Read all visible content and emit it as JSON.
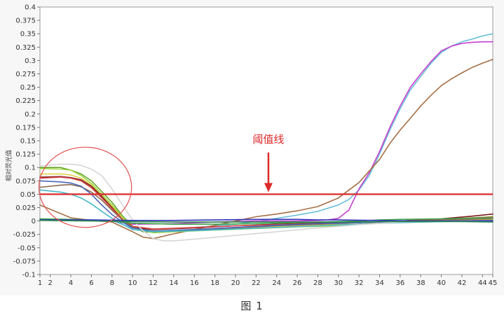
{
  "figure": {
    "caption": "图 1",
    "background": "#f7f7f7"
  },
  "chart_data": {
    "type": "line",
    "title": "",
    "xlabel": "",
    "ylabel": "相对荧光值",
    "xlim": [
      1,
      45
    ],
    "ylim": [
      -0.1,
      0.4
    ],
    "x_ticks": [
      1,
      2,
      4,
      6,
      8,
      10,
      12,
      14,
      16,
      18,
      20,
      22,
      24,
      26,
      28,
      30,
      32,
      34,
      36,
      38,
      40,
      42,
      44,
      45
    ],
    "y_ticks": [
      "0.4",
      "0.375",
      "0.35",
      "0.325",
      "0.3",
      "0.275",
      "0.25",
      "0.225",
      "0.2",
      "0.175",
      "0.15",
      "0.125",
      "0.1",
      "0.075",
      "0.05",
      "0.025",
      "0",
      "-0.025",
      "-0.05",
      "-0.075",
      "-0.1"
    ],
    "grid": false,
    "threshold": {
      "label": "阈值线",
      "value": 0.05,
      "color": "#dd2a2a"
    },
    "highlight_circle": {
      "center": [
        5.4,
        0.063
      ],
      "radii": [
        4.5,
        0.075
      ],
      "color": "#e35050"
    },
    "series": [
      {
        "color": "#6cc0d8",
        "points": [
          [
            1,
            0.003
          ],
          [
            4,
            0.003
          ],
          [
            8,
            0.001
          ],
          [
            10,
            -0.014
          ],
          [
            12,
            -0.015
          ],
          [
            14,
            -0.014
          ],
          [
            16,
            -0.012
          ],
          [
            18,
            -0.009
          ],
          [
            20,
            -0.006
          ],
          [
            22,
            -0.001
          ],
          [
            24,
            0.005
          ],
          [
            26,
            0.011
          ],
          [
            28,
            0.018
          ],
          [
            30,
            0.03
          ],
          [
            31,
            0.04
          ],
          [
            32,
            0.058
          ],
          [
            33,
            0.085
          ],
          [
            34,
            0.125
          ],
          [
            35,
            0.17
          ],
          [
            36,
            0.21
          ],
          [
            37,
            0.245
          ],
          [
            38,
            0.27
          ],
          [
            39,
            0.295
          ],
          [
            40,
            0.315
          ],
          [
            41,
            0.327
          ],
          [
            42,
            0.335
          ],
          [
            43,
            0.34
          ],
          [
            44,
            0.346
          ],
          [
            45,
            0.35
          ]
        ]
      },
      {
        "color": "#c43fd0",
        "points": [
          [
            1,
            0.002
          ],
          [
            4,
            0.002
          ],
          [
            8,
            0.0
          ],
          [
            10,
            -0.006
          ],
          [
            14,
            -0.005
          ],
          [
            18,
            -0.002
          ],
          [
            22,
            0.0
          ],
          [
            26,
            0.0
          ],
          [
            28,
            0.001
          ],
          [
            29,
            0.002
          ],
          [
            30,
            0.005
          ],
          [
            31,
            0.02
          ],
          [
            32,
            0.06
          ],
          [
            33,
            0.09
          ],
          [
            34,
            0.13
          ],
          [
            35,
            0.175
          ],
          [
            36,
            0.215
          ],
          [
            37,
            0.25
          ],
          [
            38,
            0.275
          ],
          [
            39,
            0.298
          ],
          [
            40,
            0.318
          ],
          [
            41,
            0.327
          ],
          [
            42,
            0.332
          ],
          [
            43,
            0.334
          ],
          [
            44,
            0.335
          ],
          [
            45,
            0.335
          ]
        ]
      },
      {
        "color": "#a57048",
        "points": [
          [
            1,
            0.03
          ],
          [
            4,
            0.006
          ],
          [
            6,
            0.001
          ],
          [
            8,
            -0.002
          ],
          [
            10,
            -0.02
          ],
          [
            11,
            -0.03
          ],
          [
            12,
            -0.033
          ],
          [
            14,
            -0.024
          ],
          [
            16,
            -0.016
          ],
          [
            18,
            -0.008
          ],
          [
            20,
            0.0
          ],
          [
            22,
            0.008
          ],
          [
            24,
            0.013
          ],
          [
            26,
            0.019
          ],
          [
            28,
            0.027
          ],
          [
            30,
            0.043
          ],
          [
            32,
            0.072
          ],
          [
            34,
            0.115
          ],
          [
            35,
            0.145
          ],
          [
            36,
            0.17
          ],
          [
            37,
            0.192
          ],
          [
            38,
            0.215
          ],
          [
            39,
            0.235
          ],
          [
            40,
            0.253
          ],
          [
            41,
            0.266
          ],
          [
            42,
            0.277
          ],
          [
            43,
            0.287
          ],
          [
            44,
            0.295
          ],
          [
            45,
            0.302
          ]
        ]
      },
      {
        "color": "#6aa32d",
        "points": [
          [
            1,
            0.1
          ],
          [
            3,
            0.1
          ],
          [
            4,
            0.095
          ],
          [
            5,
            0.088
          ],
          [
            6,
            0.075
          ],
          [
            7,
            0.055
          ],
          [
            8,
            0.035
          ],
          [
            9,
            0.01
          ],
          [
            10,
            -0.01
          ],
          [
            11,
            -0.02
          ],
          [
            12,
            -0.021
          ],
          [
            14,
            -0.018
          ],
          [
            16,
            -0.016
          ],
          [
            20,
            -0.013
          ],
          [
            24,
            -0.009
          ],
          [
            28,
            -0.007
          ],
          [
            32,
            -0.006
          ],
          [
            36,
            0.0
          ],
          [
            40,
            0.003
          ],
          [
            45,
            0.008
          ]
        ]
      },
      {
        "color": "#9cd640",
        "points": [
          [
            1,
            0.098
          ],
          [
            3,
            0.097
          ],
          [
            4,
            0.095
          ],
          [
            5,
            0.085
          ],
          [
            6,
            0.07
          ],
          [
            7,
            0.05
          ],
          [
            8,
            0.03
          ],
          [
            9,
            0.008
          ],
          [
            10,
            -0.012
          ],
          [
            12,
            -0.022
          ],
          [
            14,
            -0.02
          ],
          [
            18,
            -0.017
          ],
          [
            22,
            -0.014
          ],
          [
            26,
            -0.011
          ],
          [
            30,
            -0.009
          ],
          [
            34,
            -0.004
          ],
          [
            38,
            0.0
          ],
          [
            42,
            0.002
          ],
          [
            45,
            0.003
          ]
        ]
      },
      {
        "color": "#e2d04a",
        "points": [
          [
            1,
            0.088
          ],
          [
            3,
            0.088
          ],
          [
            4,
            0.086
          ],
          [
            5,
            0.08
          ],
          [
            6,
            0.067
          ],
          [
            7,
            0.047
          ],
          [
            8,
            0.027
          ],
          [
            9,
            0.005
          ],
          [
            10,
            -0.013
          ],
          [
            12,
            -0.02
          ],
          [
            16,
            -0.017
          ],
          [
            20,
            -0.013
          ],
          [
            24,
            -0.01
          ],
          [
            28,
            -0.008
          ],
          [
            32,
            -0.006
          ],
          [
            36,
            -0.002
          ],
          [
            40,
            0.001
          ],
          [
            45,
            0.002
          ]
        ]
      },
      {
        "color": "#7d1a1a",
        "points": [
          [
            1,
            0.082
          ],
          [
            3,
            0.083
          ],
          [
            4,
            0.081
          ],
          [
            5,
            0.077
          ],
          [
            6,
            0.065
          ],
          [
            7,
            0.046
          ],
          [
            8,
            0.025
          ],
          [
            9,
            0.003
          ],
          [
            10,
            -0.012
          ],
          [
            12,
            -0.016
          ],
          [
            16,
            -0.013
          ],
          [
            20,
            -0.009
          ],
          [
            24,
            -0.006
          ],
          [
            28,
            -0.004
          ],
          [
            32,
            -0.003
          ],
          [
            36,
            0.0
          ],
          [
            40,
            0.004
          ],
          [
            43,
            0.009
          ],
          [
            45,
            0.013
          ]
        ]
      },
      {
        "color": "#d8484a",
        "points": [
          [
            1,
            0.08
          ],
          [
            3,
            0.082
          ],
          [
            4,
            0.08
          ],
          [
            5,
            0.075
          ],
          [
            6,
            0.062
          ],
          [
            7,
            0.043
          ],
          [
            8,
            0.023
          ],
          [
            9,
            0.003
          ],
          [
            10,
            -0.01
          ],
          [
            12,
            -0.015
          ],
          [
            16,
            -0.012
          ],
          [
            20,
            -0.009
          ],
          [
            24,
            -0.007
          ],
          [
            28,
            -0.005
          ],
          [
            32,
            -0.003
          ],
          [
            36,
            0.0
          ],
          [
            40,
            0.003
          ],
          [
            45,
            0.007
          ]
        ]
      },
      {
        "color": "#8a6a50",
        "points": [
          [
            1,
            0.063
          ],
          [
            3,
            0.067
          ],
          [
            4,
            0.068
          ],
          [
            5,
            0.064
          ],
          [
            6,
            0.054
          ],
          [
            7,
            0.039
          ],
          [
            8,
            0.02
          ],
          [
            9,
            0.002
          ],
          [
            10,
            -0.012
          ],
          [
            12,
            -0.02
          ],
          [
            16,
            -0.017
          ],
          [
            20,
            -0.013
          ],
          [
            24,
            -0.009
          ],
          [
            28,
            -0.006
          ],
          [
            32,
            -0.003
          ],
          [
            36,
            0.0
          ],
          [
            40,
            0.002
          ],
          [
            45,
            0.004
          ]
        ]
      },
      {
        "color": "#4a66b8",
        "points": [
          [
            1,
            0.075
          ],
          [
            3,
            0.073
          ],
          [
            4,
            0.071
          ],
          [
            5,
            0.065
          ],
          [
            6,
            0.05
          ],
          [
            7,
            0.03
          ],
          [
            8,
            0.012
          ],
          [
            9,
            -0.002
          ],
          [
            10,
            -0.013
          ],
          [
            12,
            -0.019
          ],
          [
            16,
            -0.016
          ],
          [
            20,
            -0.012
          ],
          [
            24,
            -0.008
          ],
          [
            28,
            -0.005
          ],
          [
            32,
            -0.003
          ],
          [
            36,
            -0.001
          ],
          [
            40,
            0.0
          ],
          [
            45,
            0.001
          ]
        ]
      },
      {
        "color": "#48b8c8",
        "points": [
          [
            1,
            0.058
          ],
          [
            3,
            0.054
          ],
          [
            4,
            0.05
          ],
          [
            5,
            0.043
          ],
          [
            6,
            0.032
          ],
          [
            7,
            0.018
          ],
          [
            8,
            0.005
          ],
          [
            9,
            -0.006
          ],
          [
            10,
            -0.016
          ],
          [
            12,
            -0.02
          ],
          [
            16,
            -0.018
          ],
          [
            20,
            -0.015
          ],
          [
            24,
            -0.012
          ],
          [
            28,
            -0.009
          ],
          [
            32,
            -0.006
          ],
          [
            36,
            -0.003
          ],
          [
            40,
            -0.001
          ],
          [
            45,
            0.0
          ]
        ]
      },
      {
        "color": "#d6d6d6",
        "points": [
          [
            1,
            0.103
          ],
          [
            3,
            0.106
          ],
          [
            4,
            0.106
          ],
          [
            5,
            0.104
          ],
          [
            6,
            0.097
          ],
          [
            7,
            0.085
          ],
          [
            8,
            0.06
          ],
          [
            9,
            0.03
          ],
          [
            10,
            0.002
          ],
          [
            11,
            -0.018
          ],
          [
            12,
            -0.033
          ],
          [
            13,
            -0.037
          ],
          [
            14,
            -0.037
          ],
          [
            16,
            -0.034
          ],
          [
            20,
            -0.027
          ],
          [
            24,
            -0.02
          ],
          [
            28,
            -0.013
          ],
          [
            32,
            -0.007
          ],
          [
            36,
            -0.002
          ],
          [
            40,
            0.0
          ],
          [
            45,
            0.0
          ]
        ]
      },
      {
        "color": "#3da34a",
        "points": [
          [
            1,
            0.004
          ],
          [
            4,
            0.003
          ],
          [
            8,
            0.0
          ],
          [
            10,
            -0.004
          ],
          [
            14,
            -0.006
          ],
          [
            18,
            -0.006
          ],
          [
            22,
            -0.005
          ],
          [
            26,
            -0.003
          ],
          [
            30,
            -0.001
          ],
          [
            32,
            0.0
          ],
          [
            34,
            0.002
          ],
          [
            36,
            0.003
          ],
          [
            40,
            0.004
          ],
          [
            45,
            0.006
          ]
        ]
      },
      {
        "color": "#3330b8",
        "points": [
          [
            1,
            0.002
          ],
          [
            6,
            0.002
          ],
          [
            10,
            0.001
          ],
          [
            14,
            0.001
          ],
          [
            18,
            0.002
          ],
          [
            22,
            0.003
          ],
          [
            26,
            0.003
          ],
          [
            28,
            0.002
          ],
          [
            30,
            0.002
          ],
          [
            34,
            0.001
          ],
          [
            38,
            0.0
          ],
          [
            42,
            0.0
          ],
          [
            45,
            0.0
          ]
        ]
      },
      {
        "color": "#2a8a50",
        "points": [
          [
            1,
            0.001
          ],
          [
            6,
            0.0
          ],
          [
            10,
            -0.001
          ],
          [
            14,
            -0.002
          ],
          [
            18,
            -0.002
          ],
          [
            22,
            -0.002
          ],
          [
            26,
            -0.002
          ],
          [
            30,
            -0.002
          ],
          [
            34,
            -0.001
          ],
          [
            38,
            -0.001
          ],
          [
            42,
            -0.001
          ],
          [
            45,
            -0.002
          ]
        ]
      }
    ]
  }
}
